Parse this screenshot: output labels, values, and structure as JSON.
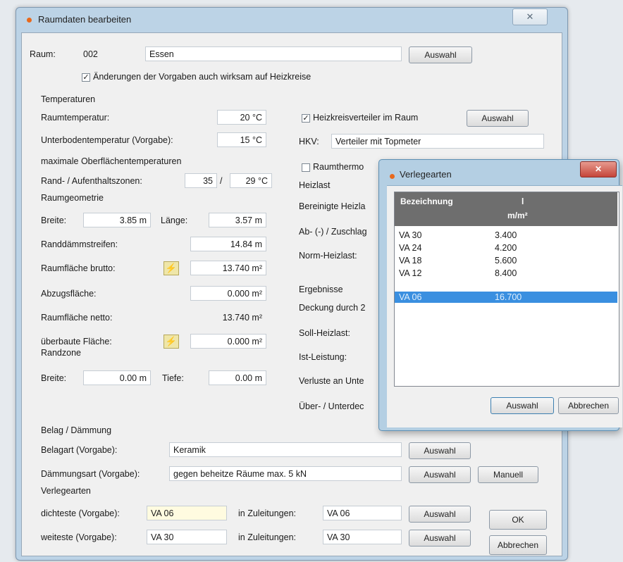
{
  "dialog": {
    "title": "Raumdaten bearbeiten",
    "close": "✕",
    "raum_label": "Raum:",
    "raum_nr": "002",
    "raum_name": "Essen",
    "auswahl": "Auswahl",
    "aenderungen_check": "Änderungen der Vorgaben auch wirksam auf Heizkreise"
  },
  "temperaturen": {
    "header": "Temperaturen",
    "raumtemp_label": "Raumtemperatur:",
    "raumtemp_value": "20 °C",
    "unterboden_label": "Unterbodentemperatur (Vorgabe):",
    "unterboden_value": "15 °C",
    "max_oberflaeche": "maximale Oberflächentemperaturen",
    "rand_label": "Rand- / Aufenthaltszonen:",
    "rand_value": "35",
    "slash": "/",
    "aufenthalt_value": "29 °C"
  },
  "geometrie": {
    "header": "Raumgeometrie",
    "breite_label": "Breite:",
    "breite_value": "3.85 m",
    "laenge_label": "Länge:",
    "laenge_value": "3.57 m",
    "randdaemm_label": "Randdämmstreifen:",
    "randdaemm_value": "14.84 m",
    "brutto_label": "Raumfläche brutto:",
    "brutto_value": "13.740 m²",
    "abzug_label": "Abzugsfläche:",
    "abzug_value": "0.000 m²",
    "netto_label": "Raumfläche netto:",
    "netto_value": "13.740 m²",
    "ueberbaut_label": "überbaute Fläche:",
    "ueberbaut_value": "0.000 m²",
    "randzone_header": "Randzone",
    "rz_breite_label": "Breite:",
    "rz_breite_value": "0.00 m",
    "rz_tiefe_label": "Tiefe:",
    "rz_tiefe_value": "0.00 m"
  },
  "heizkreis": {
    "verteiler_check": "Heizkreisverteiler im Raum",
    "hkv_label": "HKV:",
    "hkv_value": "Verteiler mit Topmeter",
    "raumthermo": "Raumthermo",
    "heizlast_header": "Heizlast",
    "bereinigte": "Bereinigte Heizla",
    "ab_zuschlag": "Ab- (-) / Zuschlag",
    "norm_heizlast": "Norm-Heizlast:",
    "ergebnisse": "Ergebnisse",
    "deckung": "Deckung durch 2",
    "soll_heizlast": "Soll-Heizlast:",
    "ist_leistung": "Ist-Leistung:",
    "verluste": "Verluste an Unte",
    "ueber_unter": "Über- / Unterdec"
  },
  "belag": {
    "header": "Belag / Dämmung",
    "belagart_label": "Belagart (Vorgabe):",
    "belagart_value": "Keramik",
    "daemmung_label": "Dämmungsart (Vorgabe):",
    "daemmung_value": "gegen beheitze Räume max. 5 kN",
    "manuell": "Manuell"
  },
  "verlegearten": {
    "header": "Verlegearten",
    "dichteste_label": "dichteste (Vorgabe):",
    "dichteste_value": "VA 06",
    "zuleitungen_label": "in Zuleitungen:",
    "dichteste_zul": "VA 06",
    "weiteste_label": "weiteste (Vorgabe):",
    "weiteste_value": "VA 30",
    "weiteste_zul": "VA 30",
    "ok": "OK",
    "abbrechen": "Abbrechen"
  },
  "popup": {
    "title": "Verlegearten",
    "close": "✕",
    "col_name": "Bezeichnung",
    "col_value": "l",
    "col_unit": "m/m²",
    "rows": [
      {
        "name": "VA 30",
        "value": "3.400"
      },
      {
        "name": "VA 24",
        "value": "4.200"
      },
      {
        "name": "VA 18",
        "value": "5.600"
      },
      {
        "name": "VA 12",
        "value": "8.400"
      },
      {
        "name": "VA 06",
        "value": "16.700"
      }
    ],
    "selected_index": 4,
    "auswahl": "Auswahl",
    "abbrechen": "Abbrechen"
  },
  "colors": {
    "selection": "#3a8fe0",
    "title_dot": "#e8691c",
    "header_bg": "#6e6e6e"
  }
}
